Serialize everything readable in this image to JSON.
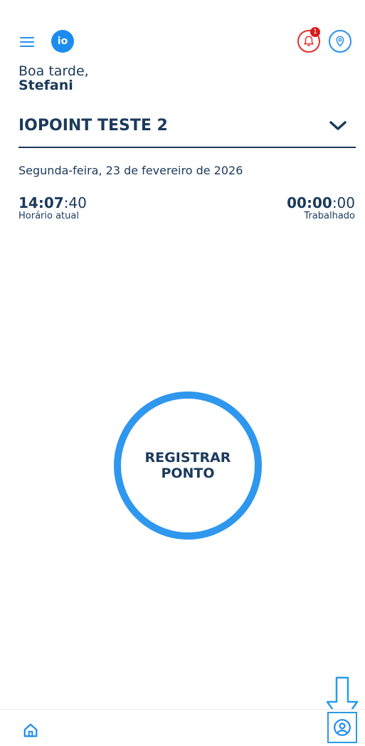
{
  "header": {
    "logo_text": "io",
    "notification_count": "1"
  },
  "greeting": {
    "line1": "Boa tarde,",
    "name": "Stefani"
  },
  "company": {
    "name": "IOPOINT TESTE 2"
  },
  "date": {
    "text": "Segunda-feira, 23 de fevereiro de 2026"
  },
  "clock": {
    "current_hm": "14:07",
    "current_s": ":40",
    "current_label": "Horário atual",
    "worked_hm": "00:00",
    "worked_s": ":00",
    "worked_label": "Trabalhado"
  },
  "register_button": {
    "line1": "REGISTRAR",
    "line2": "PONTO"
  },
  "icons": {
    "menu": "hamburger-menu-icon",
    "bell": "bell-icon",
    "location": "map-pin-icon",
    "chevron": "chevron-down-icon",
    "home": "home-icon",
    "profile": "user-circle-icon",
    "hint": "arrow-down-outline-icon"
  },
  "colors": {
    "primary_blue": "#2a8ef0",
    "ring_blue": "#2f97ee",
    "text_navy": "#1b3a5c",
    "alert_red": "#e33028"
  }
}
